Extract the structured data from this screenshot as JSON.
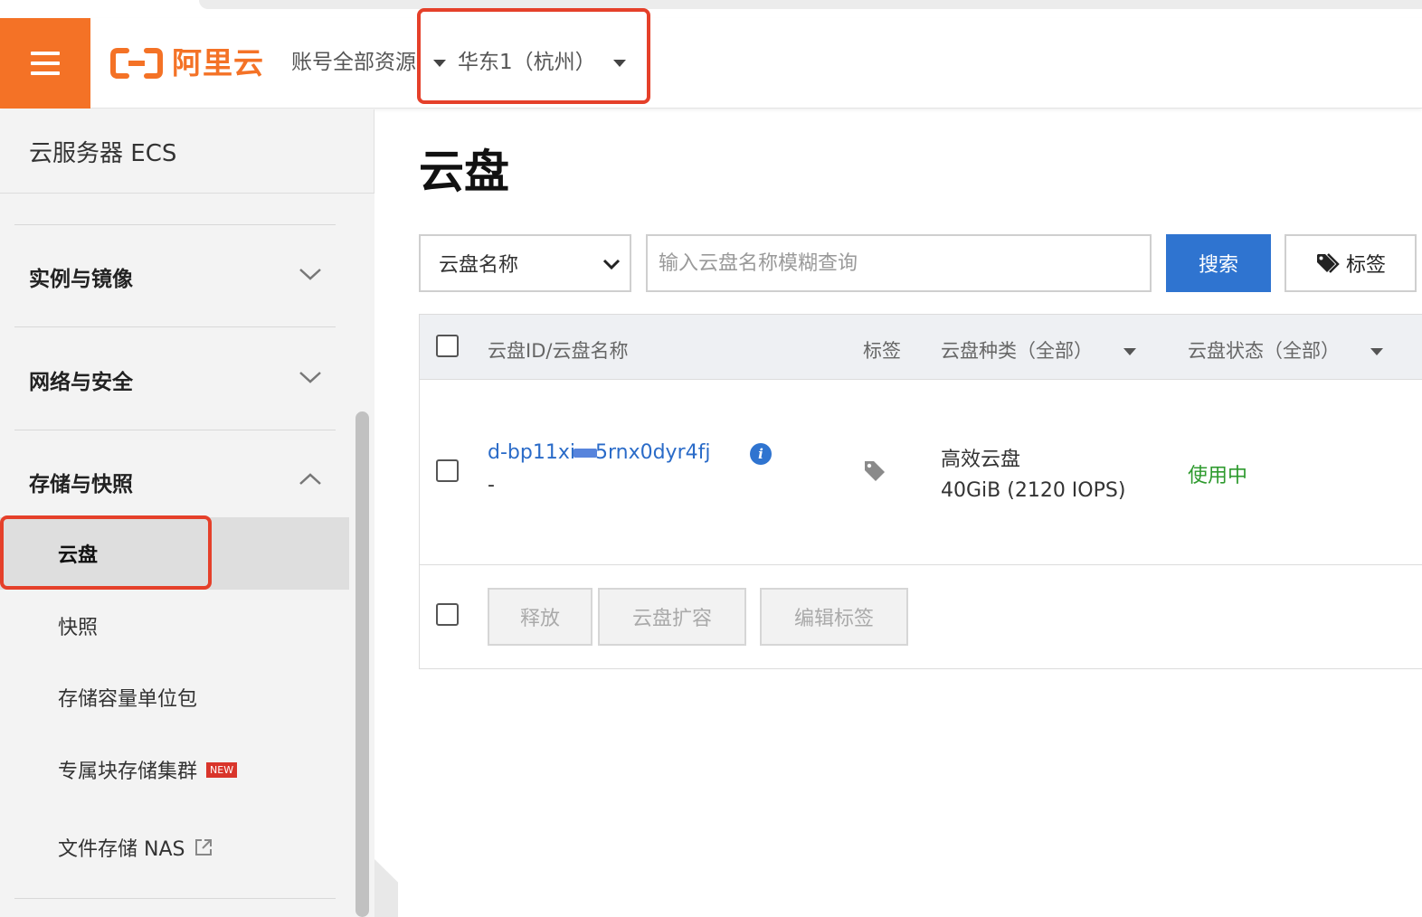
{
  "header": {
    "logo_text": "阿里云",
    "resource_selector": "账号全部资源",
    "region_selector": "华东1（杭州）"
  },
  "sidebar": {
    "title": "云服务器 ECS",
    "groups": [
      {
        "label": "实例与镜像",
        "expanded": false
      },
      {
        "label": "网络与安全",
        "expanded": false
      },
      {
        "label": "存储与快照",
        "expanded": true
      }
    ],
    "items": [
      {
        "label": "云盘",
        "active": true
      },
      {
        "label": "快照",
        "active": false
      },
      {
        "label": "存储容量单位包",
        "active": false
      },
      {
        "label": "专属块存储集群",
        "active": false,
        "badge": "NEW"
      },
      {
        "label": "文件存储 NAS",
        "active": false,
        "external": true
      }
    ]
  },
  "main": {
    "title": "云盘",
    "filter": {
      "select_value": "云盘名称",
      "search_placeholder": "输入云盘名称模糊查询",
      "search_button": "搜索",
      "tag_button": "标签"
    },
    "table": {
      "columns": [
        "云盘ID/云盘名称",
        "标签",
        "云盘种类（全部）",
        "云盘状态（全部）"
      ],
      "rows": [
        {
          "id_prefix": "d-bp11xi",
          "id_suffix": "5rnx0dyr4fj",
          "name": "-",
          "type": "高效云盘",
          "capacity": "40GiB (2120 IOPS)",
          "status": "使用中"
        }
      ],
      "bulk_actions": [
        "释放",
        "云盘扩容",
        "编辑标签"
      ]
    }
  },
  "colors": {
    "brand_orange": "#f47226",
    "primary_blue": "#2f74d0",
    "status_green": "#2e9a2e",
    "highlight_red": "#e5402a"
  },
  "icons": [
    "menu-icon",
    "aliyun-logo-icon",
    "chevron-down-icon",
    "chevron-up-icon",
    "tag-icon",
    "info-icon",
    "external-link-icon"
  ]
}
